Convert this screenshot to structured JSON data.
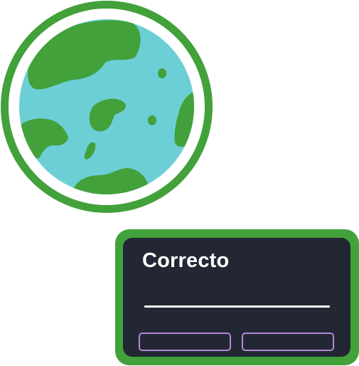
{
  "illustration": {
    "icon": "earth-globe-icon",
    "colors": {
      "ring": "#42a13b",
      "ocean": "#6dcfd6",
      "land": "#42a13b"
    }
  },
  "dialog": {
    "title": "Correcto",
    "buttons": [
      {
        "label": ""
      },
      {
        "label": ""
      }
    ],
    "colors": {
      "frame": "#42a13b",
      "panel": "#222733",
      "button_outline": "#b488d8",
      "text": "#ffffff"
    }
  }
}
